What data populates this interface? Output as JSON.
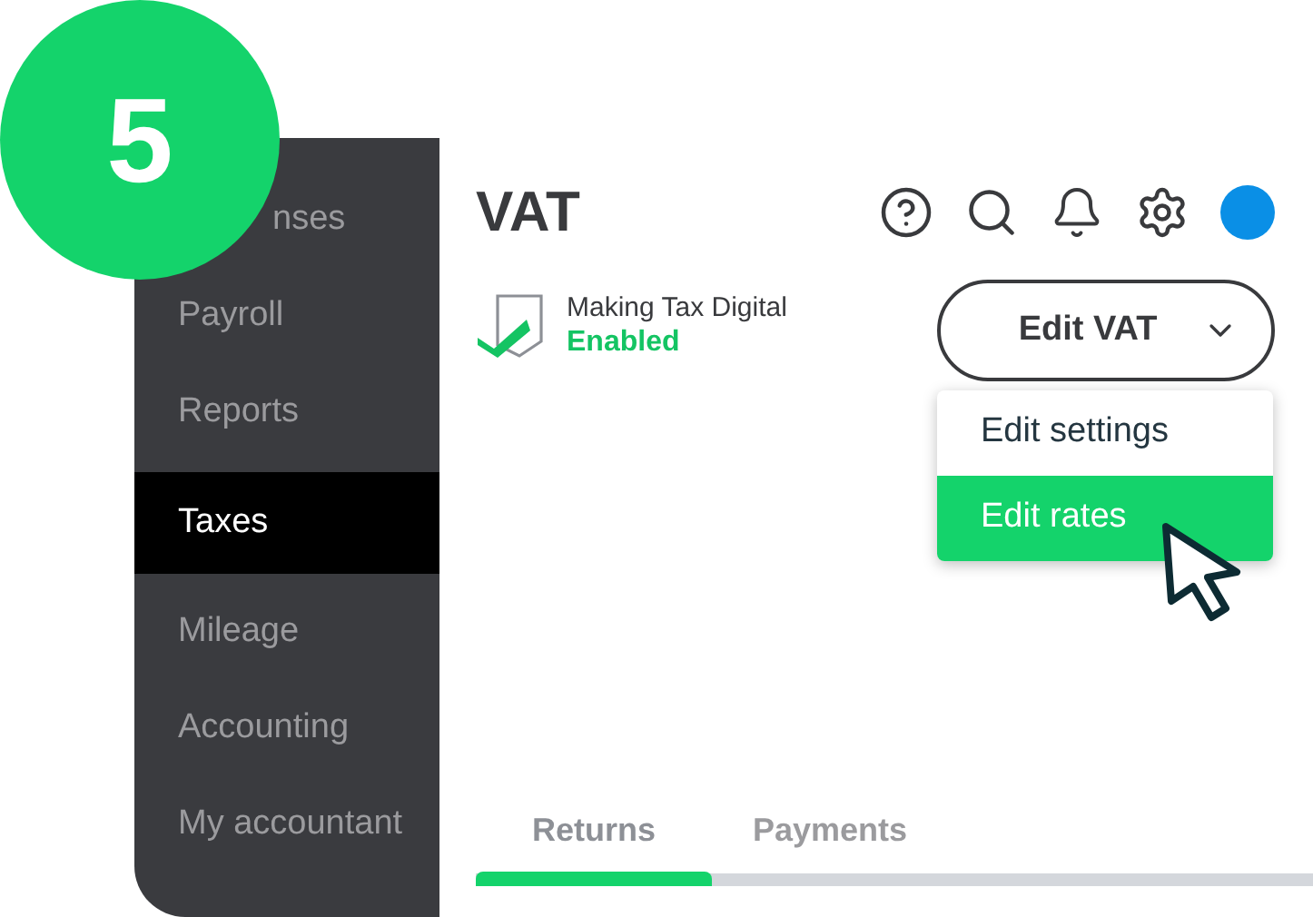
{
  "step_badge": "5",
  "sidebar": {
    "items": [
      {
        "label": "nses",
        "selected": false
      },
      {
        "label": "Payroll",
        "selected": false
      },
      {
        "label": "Reports",
        "selected": false
      },
      {
        "label": "Taxes",
        "selected": true
      },
      {
        "label": "Mileage",
        "selected": false
      },
      {
        "label": "Accounting",
        "selected": false
      },
      {
        "label": "My accountant",
        "selected": false
      }
    ]
  },
  "page": {
    "title": "VAT",
    "mtd": {
      "label": "Making Tax Digital",
      "status": "Enabled"
    }
  },
  "edit_button": {
    "label": "Edit VAT",
    "expanded": true
  },
  "menu": {
    "items": [
      {
        "label": "Edit settings",
        "selected": false
      },
      {
        "label": "Edit rates",
        "selected": true
      }
    ]
  },
  "tabs": [
    {
      "label": "Returns",
      "selected": true
    },
    {
      "label": "Payments",
      "selected": false
    }
  ]
}
